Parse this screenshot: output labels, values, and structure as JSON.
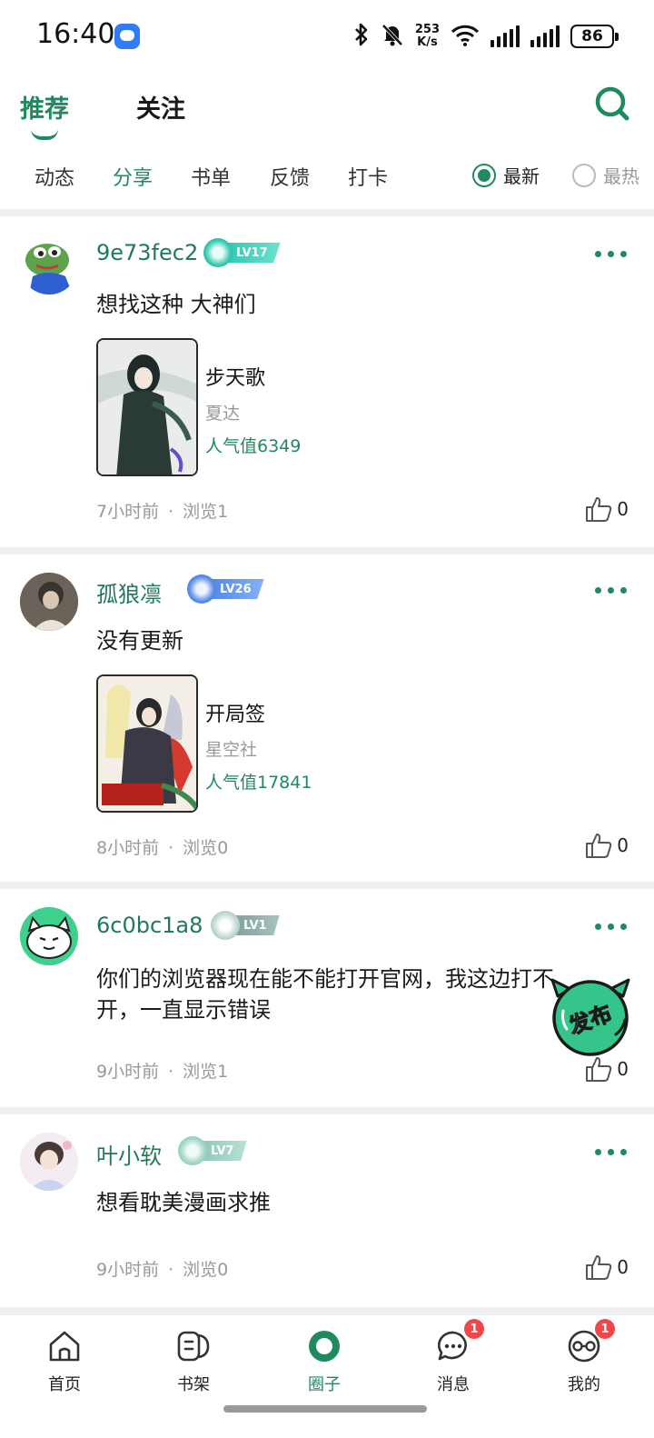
{
  "status_bar": {
    "time": "16:40",
    "net_speed_value": "253",
    "net_speed_unit": "K/s",
    "battery": "86",
    "icons": [
      "bluetooth-icon",
      "bell-muted-icon",
      "wifi-icon",
      "signal-icon",
      "signal-icon"
    ]
  },
  "top_tabs": [
    {
      "label": "推荐",
      "active": true
    },
    {
      "label": "关注",
      "active": false
    }
  ],
  "sub_tabs": [
    {
      "label": "动态",
      "active": false
    },
    {
      "label": "分享",
      "active": true
    },
    {
      "label": "书单",
      "active": false
    },
    {
      "label": "反馈",
      "active": false
    },
    {
      "label": "打卡",
      "active": false
    }
  ],
  "sort": [
    {
      "label": "最新",
      "selected": true
    },
    {
      "label": "最热",
      "selected": false
    }
  ],
  "posts": [
    {
      "username": "9e73fec2",
      "level": "LV17",
      "text": "想找这种 大神们",
      "book": {
        "title": "步天歌",
        "author": "夏达",
        "popularity": "人气值6349"
      },
      "time": "7小时前",
      "views": "浏览1",
      "likes": "0"
    },
    {
      "username": "孤狼凛",
      "level": "LV26",
      "text": "没有更新",
      "book": {
        "title": "开局签",
        "author": "星空社",
        "popularity": "人气值17841"
      },
      "time": "8小时前",
      "views": "浏览0",
      "likes": "0"
    },
    {
      "username": "6c0bc1a8",
      "level": "LV1",
      "text": "你们的浏览器现在能不能打开官网，我这边打不开，一直显示错误",
      "time": "9小时前",
      "views": "浏览1",
      "likes": "0"
    },
    {
      "username": "叶小软",
      "level": "LV7",
      "text": "想看耽美漫画求推",
      "time": "9小时前",
      "views": "浏览0",
      "likes": "0"
    }
  ],
  "fab": {
    "label": "发布"
  },
  "bottom_nav": [
    {
      "label": "首页",
      "icon": "home-icon",
      "active": false
    },
    {
      "label": "书架",
      "icon": "bookshelf-icon",
      "active": false
    },
    {
      "label": "圈子",
      "icon": "circle-icon",
      "active": true
    },
    {
      "label": "消息",
      "icon": "message-icon",
      "active": false,
      "badge": "1"
    },
    {
      "label": "我的",
      "icon": "profile-icon",
      "active": false,
      "badge": "1"
    }
  ],
  "colors": {
    "accent": "#1f8a5e",
    "badge": "#f0484a"
  }
}
